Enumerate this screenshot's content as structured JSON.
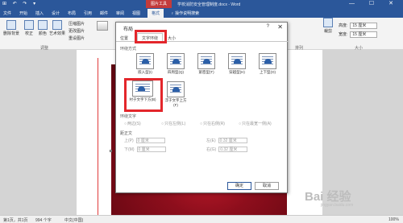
{
  "titlebar": {
    "quick_access": "⊞ ↶ ↷ ▾",
    "context_tab": "图片工具",
    "doc_title": "学校消防安全管理制度.docx - Word",
    "window_controls": "— ☐ ✕"
  },
  "tabs": [
    "文件",
    "开始",
    "插入",
    "设计",
    "布局",
    "引用",
    "邮件",
    "审阅",
    "视图",
    "格式"
  ],
  "tell_me": "♀ 操作说明搜索",
  "ribbon": {
    "remove_bg": "删除背景",
    "correct": "校正",
    "color": "颜色",
    "art": "艺术效果",
    "compress": "压缩图片",
    "change": "更改图片",
    "reset": "重设图片",
    "group_adjust": "调整",
    "group_size": "大小",
    "group_arrange": "排列",
    "height_label": "高度:",
    "height_value": "15 厘米",
    "width_label": "宽度:",
    "width_value": "15 厘米",
    "crop": "裁剪"
  },
  "dialog": {
    "title": "布局",
    "help": "?",
    "close": "✕",
    "tabs": [
      "位置",
      "文字环绕",
      "大小"
    ],
    "wrap_section": "环绕方式",
    "wrap_options": [
      "嵌入型(I)",
      "四周型(Q)",
      "紧密型(T)",
      "穿越型(H)",
      "上下型(O)",
      "衬于文字下方(B)",
      "浮于文字上方(F)"
    ],
    "wrap_text_section": "环绕文字",
    "wrap_text_options": [
      "两边(S)",
      "只在左侧(L)",
      "只在右侧(R)",
      "只在最宽一侧(A)"
    ],
    "distance_section": "距正文",
    "top_label": "上(P)",
    "top_value": "0 厘米",
    "bottom_label": "下(M)",
    "bottom_value": "0 厘米",
    "left_label": "左(E)",
    "left_value": "0.32 厘米",
    "right_label": "右(G)",
    "right_value": "0.32 厘米",
    "ok": "确定",
    "cancel": "取消"
  },
  "status": {
    "page": "第1页，共1页",
    "words": "994 个字",
    "lang": "中文(中国)",
    "zoom": "100%"
  },
  "watermark": "Bai 经验",
  "watermark_url": "jingyan.baidu.com",
  "colors": {
    "accent": "#2b579a",
    "highlight": "#e3262b",
    "context": "#c33b3b"
  }
}
